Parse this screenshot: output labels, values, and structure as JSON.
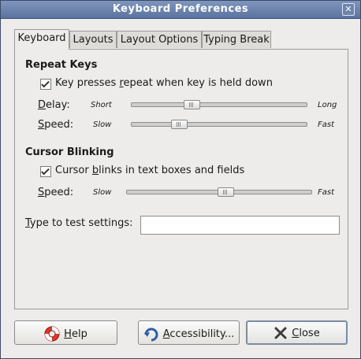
{
  "window": {
    "title": "Keyboard Preferences",
    "close_glyph": "✕"
  },
  "tabs": [
    {
      "label": "Keyboard",
      "active": true
    },
    {
      "label": "Layouts",
      "active": false
    },
    {
      "label": "Layout Options",
      "active": false
    },
    {
      "label": "Typing Break",
      "active": false
    }
  ],
  "repeat_keys": {
    "title": "Repeat Keys",
    "checkbox_pre": "Key presses ",
    "checkbox_mn": "r",
    "checkbox_post": "epeat when key is held down",
    "checked": true,
    "delay": {
      "label_mn": "D",
      "label_rest": "elay:",
      "min": "Short",
      "max": "Long",
      "value": 0.33
    },
    "speed": {
      "label_mn": "S",
      "label_rest": "peed:",
      "min": "Slow",
      "max": "Fast",
      "value": 0.25
    }
  },
  "cursor_blinking": {
    "title": "Cursor Blinking",
    "checkbox_pre": "Cursor ",
    "checkbox_mn": "b",
    "checkbox_post": "links in text boxes and fields",
    "checked": true,
    "speed": {
      "label_mn": "S",
      "label_rest": "peed:",
      "min": "Slow",
      "max": "Fast",
      "value": 0.54
    }
  },
  "test": {
    "label_mn": "T",
    "label_rest": "ype to test settings:",
    "value": ""
  },
  "buttons": {
    "help": {
      "mn": "H",
      "rest": "elp"
    },
    "accessibility": {
      "mn": "A",
      "rest": "ccessibility..."
    },
    "close": {
      "mn": "C",
      "rest": "lose"
    }
  },
  "colors": {
    "title_bar": "#6b82ad",
    "focus": "#6f8ab8"
  }
}
